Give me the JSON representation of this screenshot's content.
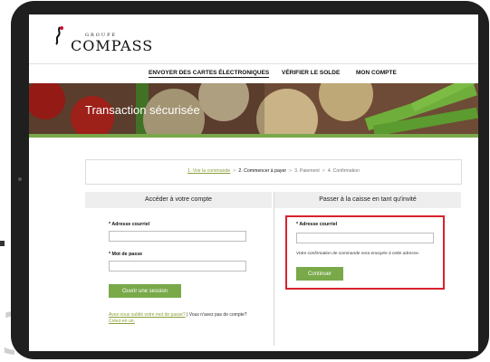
{
  "logo": {
    "small": "GROUPE",
    "big": "COMPASS"
  },
  "nav": {
    "items": [
      {
        "label": "ENVOYER DES CARTES ÉLECTRONIQUES",
        "active": true
      },
      {
        "label": "VÉRIFIER LE SOLDE",
        "active": false
      },
      {
        "label": "MON COMPTE",
        "active": false
      }
    ]
  },
  "banner": {
    "title": "Transaction sécurisée"
  },
  "breadcrumb": {
    "step1": "1. Voir la commande",
    "step2": "2. Commencer à payer",
    "step3": "3. Paiement",
    "step4": "4. Confirmation",
    "separator": ">"
  },
  "login": {
    "heading": "Accéder à votre compte",
    "email_label": "* Adresse courriel",
    "email_value": "",
    "password_label": "* Mot de passe",
    "password_value": "",
    "submit_label": "Ouvrir une session",
    "forgot_link": "Avez-vous oublié votre mot de passe?",
    "separator": "|",
    "no_account_text": "Vous n'avez pas de compte?",
    "create_link": "Créez-en un."
  },
  "guest": {
    "heading": "Passer à la caisse en tant qu'invité",
    "email_label": "* Adresse courriel",
    "email_value": "",
    "note": "Votre confirmation de commande sera envoyée à cette adresse.",
    "continue_label": "Continuer"
  },
  "colors": {
    "accent_green": "#79a949",
    "link_green": "#8aa13b",
    "highlight_red": "#d8222c",
    "device_frame": "#1f1f1f"
  }
}
